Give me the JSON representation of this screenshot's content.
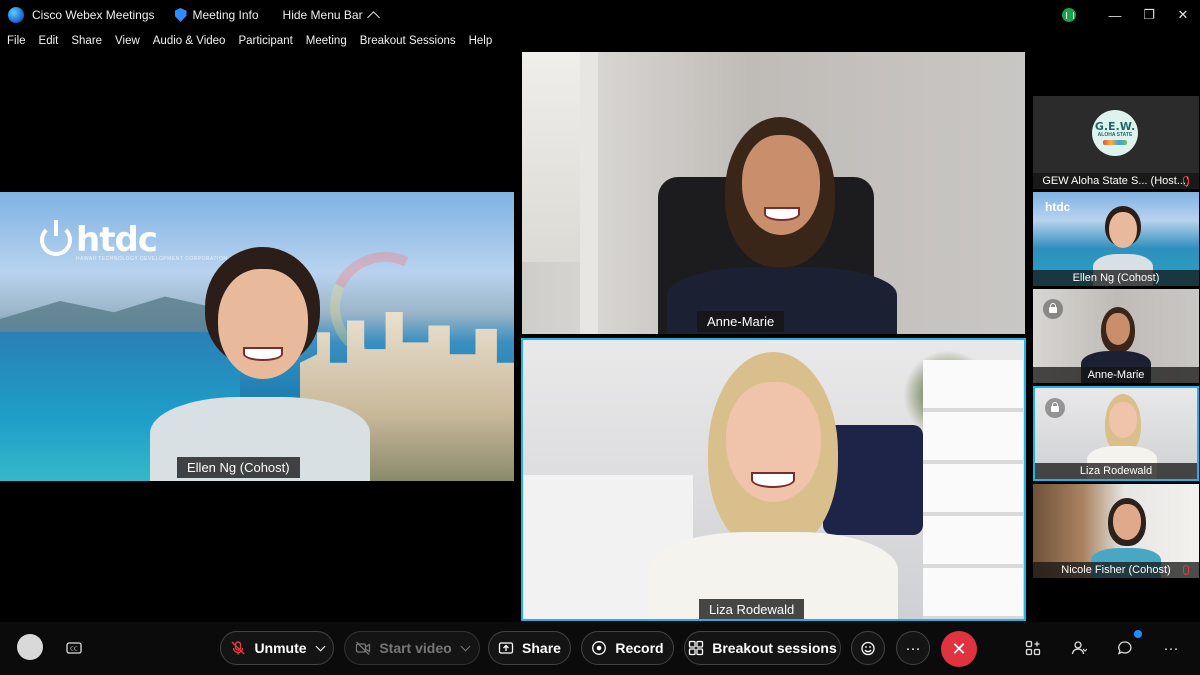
{
  "titlebar": {
    "app_title": "Cisco Webex Meetings",
    "meeting_info": "Meeting Info",
    "hide_menu": "Hide Menu Bar",
    "minimize": "—",
    "restore": "❐",
    "close": "✕"
  },
  "menu": [
    "File",
    "Edit",
    "Share",
    "View",
    "Audio & Video",
    "Participant",
    "Meeting",
    "Breakout Sessions",
    "Help"
  ],
  "tiles": {
    "ellen": {
      "name": "Ellen Ng (Cohost)",
      "logo_text": "htdc",
      "logo_subtext": "HAWAII TECHNOLOGY DEVELOPMENT CORPORATION"
    },
    "anne": {
      "name": "Anne-Marie"
    },
    "liza": {
      "name": "Liza Rodewald"
    }
  },
  "sidebar": [
    {
      "name": "GEW Aloha State S... (Host...)",
      "badge_title": "G.E.W.",
      "badge_sub": "ALOHA STATE"
    },
    {
      "name": "Ellen Ng  (Cohost)",
      "logo_text": "htdc"
    },
    {
      "name": "Anne-Marie"
    },
    {
      "name": "Liza Rodewald"
    },
    {
      "name": "Nicole Fisher  (Cohost)"
    }
  ],
  "controls": {
    "unmute": "Unmute",
    "start_video": "Start video",
    "share": "Share",
    "record": "Record",
    "breakout": "Breakout sessions",
    "more": "···",
    "end": "✕"
  },
  "colors": {
    "active_border": "#1fb4e6",
    "end_call": "#e0323f",
    "mic_muted": "#e53b3b"
  }
}
